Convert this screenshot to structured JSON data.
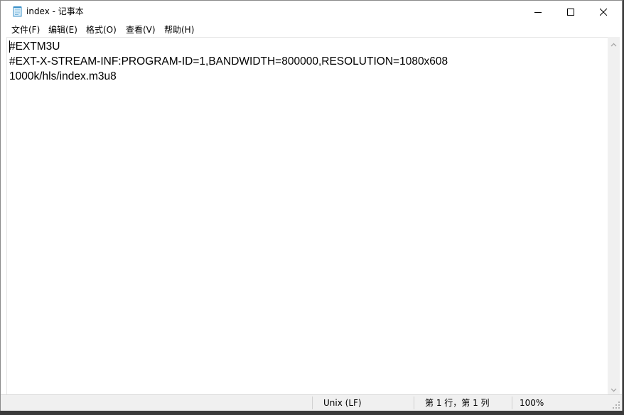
{
  "window": {
    "title": "index - 记事本",
    "app_icon": "notepad-icon",
    "controls": {
      "minimize_icon": "minimize-icon",
      "maximize_icon": "maximize-icon",
      "close_icon": "close-icon"
    }
  },
  "menu": {
    "items": [
      {
        "label": "文件(F)"
      },
      {
        "label": "编辑(E)"
      },
      {
        "label": "格式(O)"
      },
      {
        "label": "查看(V)"
      },
      {
        "label": "帮助(H)"
      }
    ]
  },
  "editor": {
    "lines": [
      "#EXTM3U",
      "#EXT-X-STREAM-INF:PROGRAM-ID=1,BANDWIDTH=800000,RESOLUTION=1080x608",
      "1000k/hls/index.m3u8"
    ]
  },
  "scrollbar": {
    "up_icon": "scroll-up-arrow-icon",
    "down_icon": "scroll-down-arrow-icon"
  },
  "status": {
    "line_ending": "Unix (LF)",
    "position": "第 1 行，第 1 列",
    "zoom": "100%"
  }
}
